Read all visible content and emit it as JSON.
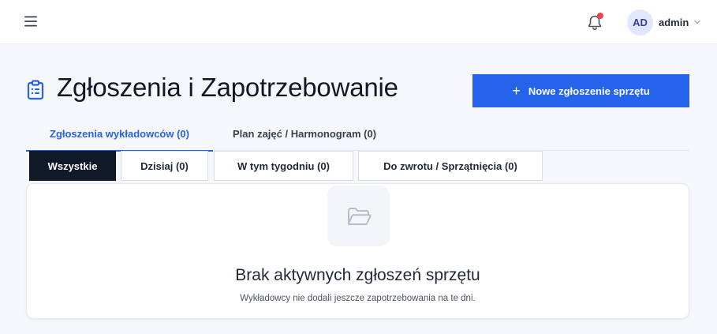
{
  "header": {
    "menu_icon": "hamburger-menu-icon",
    "notification_icon": "bell-icon",
    "notification_badge_color": "#ef4444",
    "user": {
      "initials": "AD",
      "name": "admin",
      "chevron_icon": "chevron-down-icon"
    }
  },
  "page": {
    "icon": "clipboard-list-icon",
    "title": "Zgłoszenia i Zapotrzebowanie",
    "new_button": {
      "icon": "plus-icon",
      "label": "Nowe zgłoszenie sprzętu",
      "color": "#2563eb"
    }
  },
  "tabs": [
    {
      "label": "Zgłoszenia wykładowców (0)",
      "active": true
    },
    {
      "label": "Plan zajęć / Harmonogram (0)",
      "active": false
    }
  ],
  "filters": [
    {
      "label": "Wszystkie",
      "active": true
    },
    {
      "label": "Dzisiaj (0)",
      "active": false
    },
    {
      "label": "W tym tygodniu (0)",
      "active": false
    },
    {
      "label": "Do zwrotu / Sprzątnięcia (0)",
      "active": false
    }
  ],
  "empty_state": {
    "icon": "folder-open-icon",
    "title": "Brak aktywnych zgłoszeń sprzętu",
    "subtitle": "Wykładowcy nie dodali jeszcze zapotrzebowania na te dni."
  }
}
